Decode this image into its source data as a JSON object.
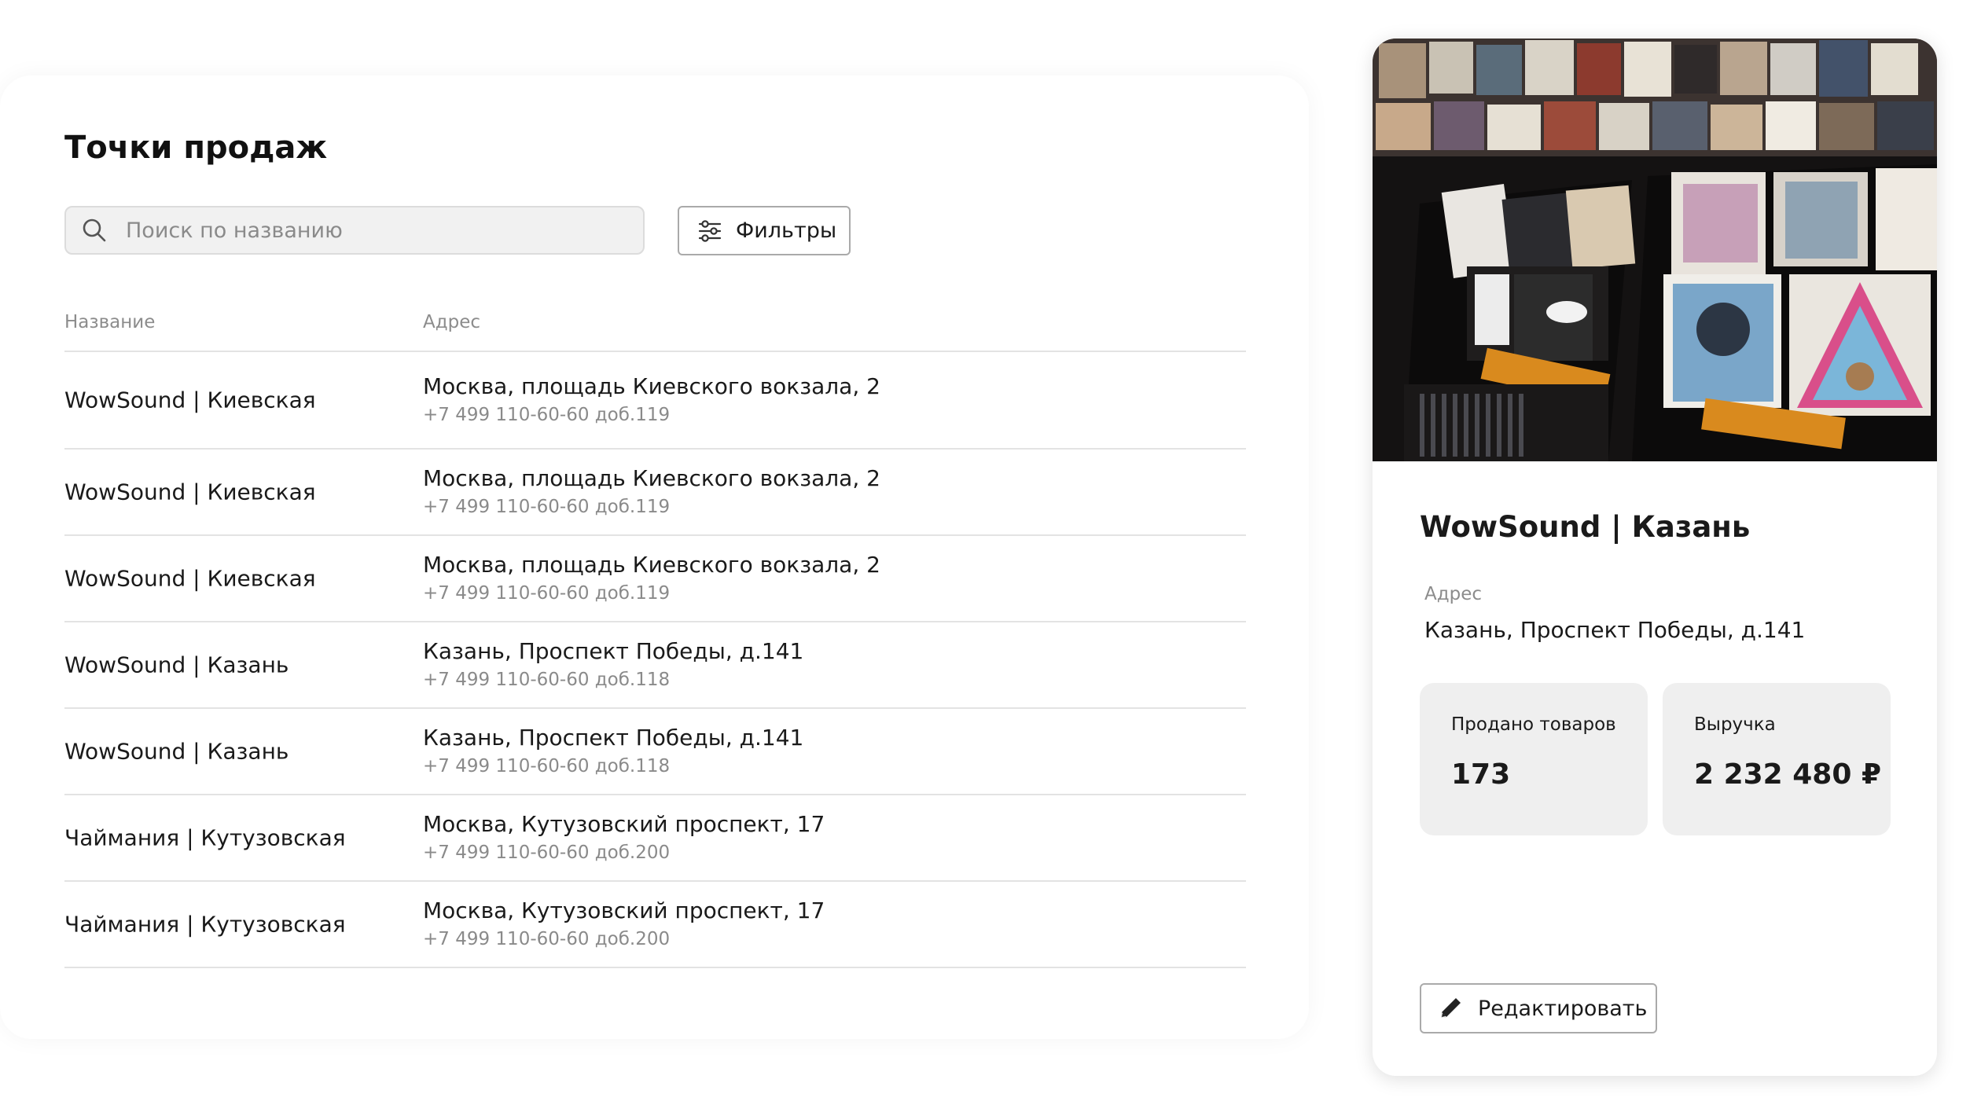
{
  "page": {
    "title": "Точки продаж"
  },
  "search": {
    "placeholder": "Поиск по названию",
    "value": ""
  },
  "filters": {
    "label": "Фильтры"
  },
  "table": {
    "columns": [
      "Название",
      "Адрес"
    ],
    "rows": [
      {
        "name": "WowSound | Киевская",
        "address": "Москва, площадь Киевского вокзала, 2",
        "phone": "+7 499 110-60-60 доб.119"
      },
      {
        "name": "WowSound | Киевская",
        "address": "Москва, площадь Киевского вокзала, 2",
        "phone": "+7 499 110-60-60 доб.119"
      },
      {
        "name": "WowSound | Киевская",
        "address": "Москва, площадь Киевского вокзала, 2",
        "phone": "+7 499 110-60-60 доб.119"
      },
      {
        "name": "WowSound | Казань",
        "address": "Казань, Проспект Победы, д.141",
        "phone": "+7 499 110-60-60 доб.118"
      },
      {
        "name": "WowSound | Казань",
        "address": "Казань, Проспект Победы, д.141",
        "phone": "+7 499 110-60-60 доб.118"
      },
      {
        "name": "Чаймания | Кутузовская",
        "address": "Москва, Кутузовский проспект, 17",
        "phone": "+7 499 110-60-60 доб.200"
      },
      {
        "name": "Чаймания | Кутузовская",
        "address": "Москва, Кутузовский проспект, 17",
        "phone": "+7 499 110-60-60 доб.200"
      }
    ]
  },
  "detail": {
    "title": "WowSound | Казань",
    "address_label": "Адрес",
    "address": "Казань, Проспект Победы, д.141",
    "stats": [
      {
        "label": "Продано товаров",
        "value": "173"
      },
      {
        "label": "Выручка",
        "value": "2 232 480 ₽"
      }
    ],
    "edit_label": "Редактировать"
  },
  "icons": {
    "search": "search-icon",
    "filters": "sliders-icon",
    "edit": "pencil-icon"
  }
}
